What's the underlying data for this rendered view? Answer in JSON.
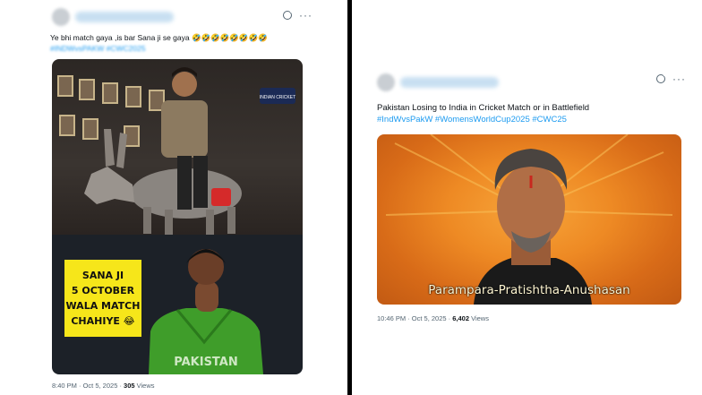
{
  "left_post": {
    "text": "Ye bhi match gaya ,is bar Sana ji se gaya 🤣🤣🤣🤣🤣🤣🤣🤣",
    "hashtags": "#INDWvsPAKW #CWC2025",
    "meme": {
      "badge_text": "INDIAN CRICKET",
      "card_lines": [
        "SANA JI",
        "5 OCTOBER",
        "WALA MATCH",
        "CHAHIYE 😂"
      ],
      "jersey_text": "PAKISTAN"
    },
    "meta": {
      "time_date": "8:40 PM · Oct 5, 2025 · ",
      "views_count": "305",
      "views_label": " Views"
    }
  },
  "right_post": {
    "text": "Pakistan Losing to India in Cricket Match or in Battlefield",
    "hashtags": "#IndWvsPakW #WomensWorldCup2025 #CWC25",
    "meme": {
      "caption": "Parampara-Pratishtha-Anushasan"
    },
    "meta": {
      "time_date": "10:46 PM · Oct 5, 2025 · ",
      "views_count": "6,402",
      "views_label": " Views"
    }
  },
  "icons": {
    "grok": "grok-icon",
    "more": "more-options-icon"
  },
  "colors": {
    "link": "#1d9bf0",
    "divider": "#000000",
    "meta": "#536471",
    "card": "#f6e61a"
  }
}
